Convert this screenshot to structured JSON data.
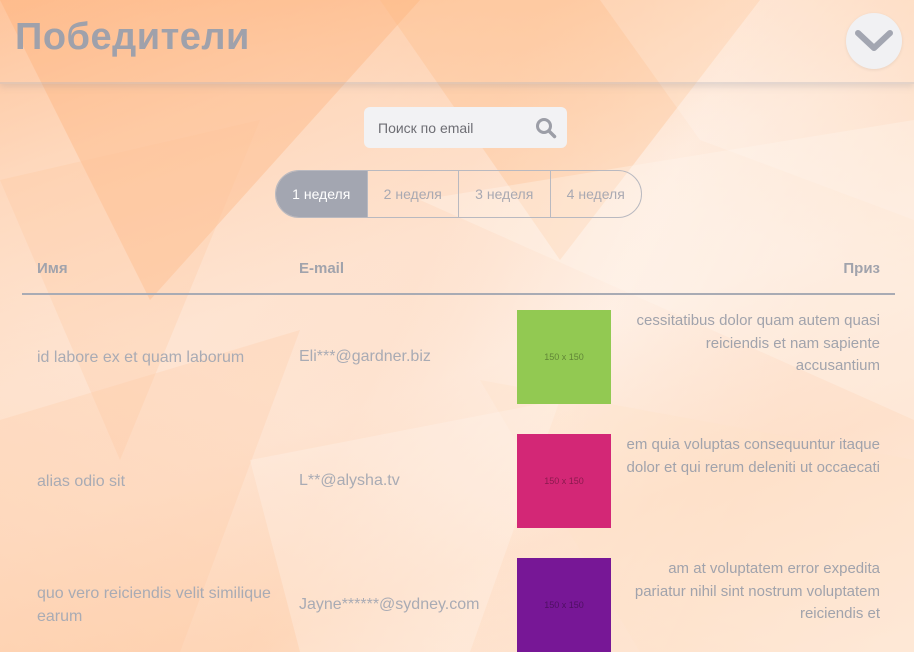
{
  "header": {
    "title": "Победители"
  },
  "search": {
    "placeholder": "Поиск по email",
    "value": ""
  },
  "weeks": [
    {
      "label": "1 неделя",
      "active": true
    },
    {
      "label": "2 неделя",
      "active": false
    },
    {
      "label": "3 неделя",
      "active": false
    },
    {
      "label": "4 неделя",
      "active": false
    }
  ],
  "table": {
    "headers": {
      "name": "Имя",
      "email": "E-mail",
      "prize": "Приз"
    },
    "rows": [
      {
        "name": "id labore ex et quam laborum",
        "email": "Eli***@gardner.biz",
        "image_label": "150 x 150",
        "image_color": "#92c952",
        "prize": "cessitatibus dolor quam autem quasi reiciendis et nam sapiente accusantium"
      },
      {
        "name": "alias odio sit",
        "email": "L**@alysha.tv",
        "image_label": "150 x 150",
        "image_color": "#d32776",
        "prize": "em quia voluptas consequuntur itaque dolor et qui rerum deleniti ut occaecati"
      },
      {
        "name": "quo vero reiciendis velit similique earum",
        "email": "Jayne******@sydney.com",
        "image_label": "150 x 150",
        "image_color": "#771796",
        "prize": "am at voluptatem error expedita pariatur nihil sint nostrum voluptatem reiciendis et"
      }
    ]
  },
  "colors": {
    "accent": "#a3a6b1",
    "text": "#a9abb4",
    "background": "#fde9dc"
  }
}
